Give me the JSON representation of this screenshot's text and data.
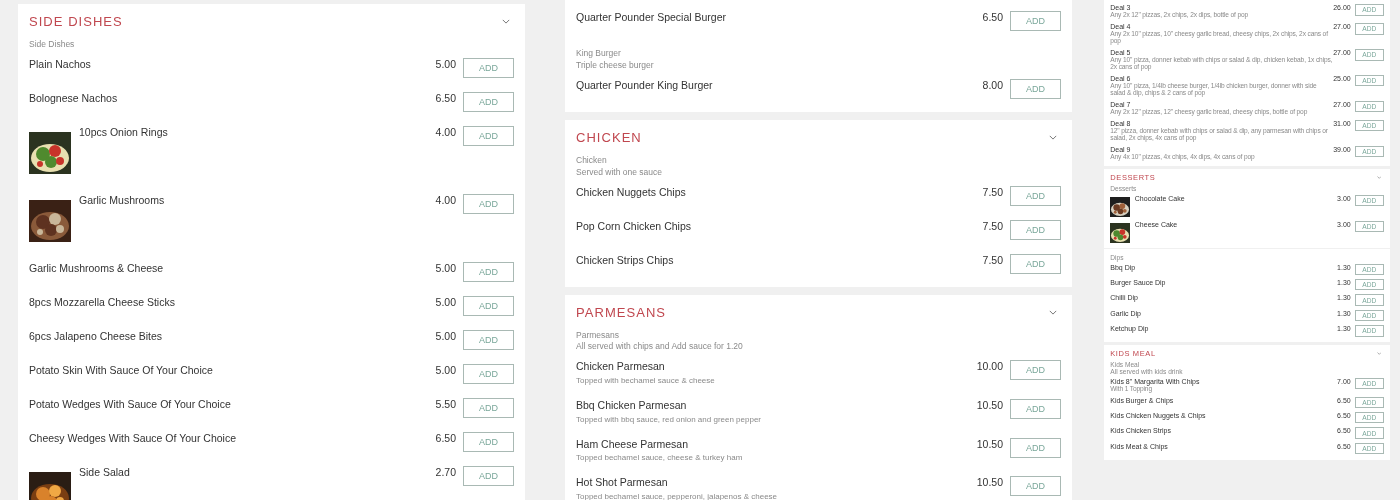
{
  "columns": [
    {
      "cards": [
        {
          "title": "SIDE DISHES",
          "expanded": true,
          "groups": [
            {
              "notes": [
                "Side Dishes"
              ],
              "items": [
                {
                  "name": "Plain Nachos",
                  "price": "5.00",
                  "button": "ADD"
                },
                {
                  "name": "Bolognese Nachos",
                  "price": "6.50",
                  "button": "ADD"
                },
                {
                  "name": "10pcs Onion Rings",
                  "price": "4.00",
                  "button": "ADD",
                  "kind": "picture"
                },
                {
                  "name": "Garlic Mushrooms",
                  "price": "4.00",
                  "button": "ADD",
                  "kind": "picture"
                },
                {
                  "name": "Garlic Mushrooms & Cheese",
                  "price": "5.00",
                  "button": "ADD"
                },
                {
                  "name": "8pcs Mozzarella Cheese Sticks",
                  "price": "5.00",
                  "button": "ADD"
                },
                {
                  "name": "6pcs Jalapeno Cheese Bites",
                  "price": "5.00",
                  "button": "ADD"
                },
                {
                  "name": "Potato Skin With Sauce Of Your Choice",
                  "price": "5.00",
                  "button": "ADD"
                },
                {
                  "name": "Potato Wedges With Sauce Of Your Choice",
                  "price": "5.50",
                  "button": "ADD"
                },
                {
                  "name": "Cheesy Wedges With Sauce Of Your Choice",
                  "price": "6.50",
                  "button": "ADD"
                },
                {
                  "name": "Side Salad",
                  "price": "2.70",
                  "button": "ADD",
                  "kind": "picture"
                }
              ]
            }
          ]
        }
      ]
    },
    {
      "cards": [
        {
          "groups": [
            {
              "items": [
                {
                  "name": "Quarter Pounder Special Burger",
                  "price": "6.50",
                  "button": "ADD"
                }
              ]
            },
            {
              "notes": [
                "King Burger",
                "Triple cheese burger"
              ],
              "items": [
                {
                  "name": "Quarter Pounder King Burger",
                  "price": "8.00",
                  "button": "ADD"
                }
              ]
            }
          ]
        },
        {
          "title": "CHICKEN",
          "expanded": true,
          "groups": [
            {
              "notes": [
                "Chicken",
                "Served with one sauce"
              ],
              "items": [
                {
                  "name": "Chicken Nuggets Chips",
                  "price": "7.50",
                  "button": "ADD"
                },
                {
                  "name": "Pop Corn Chicken Chips",
                  "price": "7.50",
                  "button": "ADD"
                },
                {
                  "name": "Chicken Strips Chips",
                  "price": "7.50",
                  "button": "ADD"
                }
              ]
            }
          ]
        },
        {
          "title": "PARMESANS",
          "expanded": true,
          "groups": [
            {
              "notes": [
                "Parmesans",
                "All served with chips and Add sauce for 1.20"
              ],
              "items": [
                {
                  "name": "Chicken Parmesan",
                  "description": "Topped with bechamel sauce & cheese",
                  "price": "10.00",
                  "button": "ADD"
                },
                {
                  "name": "Bbq Chicken Parmesan",
                  "description": "Topped with bbq sauce, red onion and green pepper",
                  "price": "10.50",
                  "button": "ADD"
                },
                {
                  "name": "Ham Cheese Parmesan",
                  "description": "Topped bechamel sauce, cheese & turkey ham",
                  "price": "10.50",
                  "button": "ADD"
                },
                {
                  "name": "Hot Shot Parmesan",
                  "description": "Topped bechamel sauce, pepperoni, jalapenos & cheese",
                  "price": "10.50",
                  "button": "ADD"
                }
              ]
            }
          ]
        }
      ]
    },
    {
      "cards": [
        {
          "groups": [
            {
              "items": [
                {
                  "name": "Deal 3",
                  "description": "Any 2x 12\" pizzas, 2x chips, 2x dips, bottle of pop",
                  "price": "26.00",
                  "button": "ADD"
                },
                {
                  "name": "Deal 4",
                  "description": "Any 2x 10\" pizzas, 10\" cheesy garlic bread, cheesy chips, 2x chips, 2x cans of pop",
                  "price": "27.00",
                  "button": "ADD"
                },
                {
                  "name": "Deal 5",
                  "description": "Any 10\" pizza, donner kebab with chips or salad & dip, chicken kebab, 1x chips, 2x cans of pop",
                  "price": "27.00",
                  "button": "ADD"
                },
                {
                  "name": "Deal 6",
                  "description": "Any 10\" pizza, 1/4lb cheese burger, 1/4lb chicken burger, donner with side salad & dip, chips & 2 cans of pop",
                  "price": "25.00",
                  "button": "ADD"
                },
                {
                  "name": "Deal 7",
                  "description": "Any 2x 12\" pizzas, 12\" cheesy garlic bread, cheesy chips, bottle of pop",
                  "price": "27.00",
                  "button": "ADD"
                },
                {
                  "name": "Deal 8",
                  "description": "12\" pizza, donner kebab with chips or salad & dip, any parmesan with chips or salad, 2x chips, 4x cans of pop",
                  "price": "31.00",
                  "button": "ADD"
                },
                {
                  "name": "Deal 9",
                  "description": "Any 4x 10\" pizzas, 4x chips, 4x dips, 4x cans of pop",
                  "price": "39.00",
                  "button": "ADD"
                }
              ]
            }
          ]
        },
        {
          "title": "DESSERTS",
          "expanded": true,
          "groups": [
            {
              "notes": [
                "Desserts"
              ],
              "items": [
                {
                  "name": "Chocolate Cake",
                  "price": "3.00",
                  "button": "ADD",
                  "kind": "picture"
                },
                {
                  "name": "Cheese Cake",
                  "price": "3.00",
                  "button": "ADD",
                  "kind": "picture"
                }
              ]
            }
          ]
        },
        {
          "groups": [
            {
              "notes": [
                "Dips"
              ],
              "items": [
                {
                  "name": "Bbq Dip",
                  "price": "1.30",
                  "button": "ADD"
                },
                {
                  "name": "Burger Sauce Dip",
                  "price": "1.30",
                  "button": "ADD"
                },
                {
                  "name": "Chilli Dip",
                  "price": "1.30",
                  "button": "ADD"
                },
                {
                  "name": "Garlic Dip",
                  "price": "1.30",
                  "button": "ADD"
                },
                {
                  "name": "Ketchup Dip",
                  "price": "1.30",
                  "button": "ADD"
                }
              ]
            }
          ]
        },
        {
          "title": "KIDS MEAL",
          "expanded": true,
          "groups": [
            {
              "notes": [
                "Kids Meal",
                "All served with kids drink"
              ],
              "items": [
                {
                  "name": "Kids 8\" Margarita With Chips",
                  "description": "With 1 Topping",
                  "price": "7.00",
                  "button": "ADD"
                },
                {
                  "name": "Kids Burger & Chips",
                  "price": "6.50",
                  "button": "ADD"
                },
                {
                  "name": "Kids Chicken Nuggets & Chips",
                  "price": "6.50",
                  "button": "ADD"
                },
                {
                  "name": "Kids Chicken Strips",
                  "price": "6.50",
                  "button": "ADD"
                },
                {
                  "name": "Kids Meat & Chips",
                  "price": "6.50",
                  "button": "ADD"
                }
              ]
            }
          ]
        }
      ]
    }
  ]
}
